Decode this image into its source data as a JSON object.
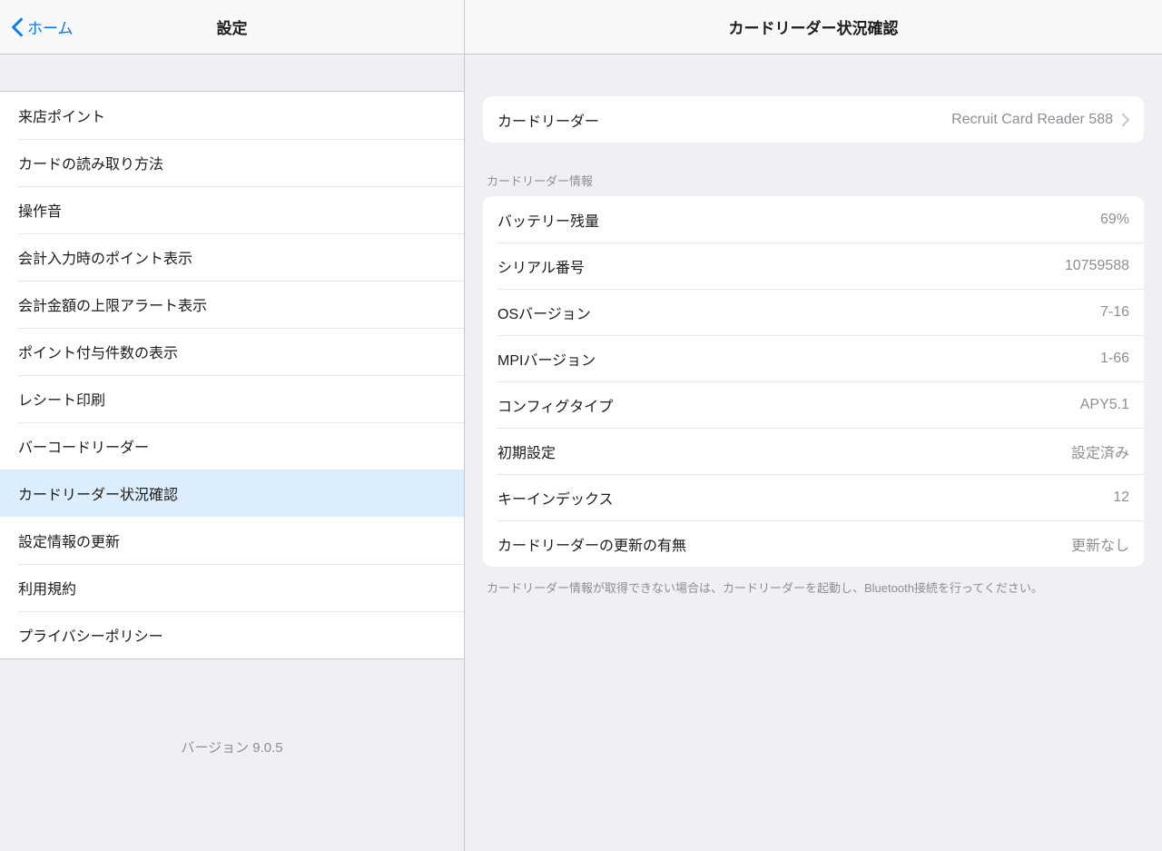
{
  "master": {
    "back_label": "ホーム",
    "title": "設定",
    "items": [
      {
        "label": "来店ポイント"
      },
      {
        "label": "カードの読み取り方法"
      },
      {
        "label": "操作音"
      },
      {
        "label": "会計入力時のポイント表示"
      },
      {
        "label": "会計金額の上限アラート表示"
      },
      {
        "label": "ポイント付与件数の表示"
      },
      {
        "label": "レシート印刷"
      },
      {
        "label": "バーコードリーダー"
      },
      {
        "label": "カードリーダー状況確認"
      },
      {
        "label": "設定情報の更新"
      },
      {
        "label": "利用規約"
      },
      {
        "label": "プライバシーポリシー"
      }
    ],
    "version": "バージョン 9.0.5"
  },
  "detail": {
    "title": "カードリーダー状況確認",
    "reader": {
      "label": "カードリーダー",
      "value": "Recruit Card Reader 588"
    },
    "section_header": "カードリーダー情報",
    "info": [
      {
        "label": "バッテリー残量",
        "value": "69%"
      },
      {
        "label": "シリアル番号",
        "value": "10759588"
      },
      {
        "label": "OSバージョン",
        "value": "7-16"
      },
      {
        "label": "MPIバージョン",
        "value": "1-66"
      },
      {
        "label": "コンフィグタイプ",
        "value": "APY5.1"
      },
      {
        "label": "初期設定",
        "value": "設定済み"
      },
      {
        "label": "キーインデックス",
        "value": "12"
      },
      {
        "label": "カードリーダーの更新の有無",
        "value": "更新なし"
      }
    ],
    "footer_note": "カードリーダー情報が取得できない場合は、カードリーダーを起動し、Bluetooth接続を行ってください。"
  }
}
